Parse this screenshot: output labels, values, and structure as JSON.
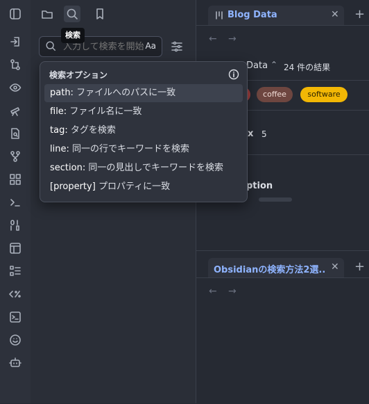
{
  "tooltip": "検索",
  "search": {
    "value": "入力して検索を開始...",
    "match_case": "Aa"
  },
  "popup": {
    "title": "検索オプション",
    "options": [
      {
        "key": "path:",
        "desc": "ファイルへのパスに一致"
      },
      {
        "key": "file:",
        "desc": "ファイル名に一致"
      },
      {
        "key": "tag:",
        "desc": "タグを検索"
      },
      {
        "key": "line:",
        "desc": "同一の行でキーワードを検索"
      },
      {
        "key": "section:",
        "desc": "同一の見出しでキーワードを検索"
      },
      {
        "key": "[property]",
        "desc": "プロパティに一致"
      }
    ]
  },
  "top_pane": {
    "tab_title": "Blog Data",
    "view_name": "Data",
    "result_count": "24 件の結果",
    "tags": [
      "coffee",
      "software"
    ],
    "group_label": "x",
    "group_count": "5",
    "option_label": "ption"
  },
  "bottom_pane": {
    "tab_title": "Obsidianの検索方法2選..."
  },
  "colors": {
    "accent": "#8fb4ff",
    "search_active": "#e0605a",
    "tag_coffee": "#6e4640",
    "tag_software": "#f2b705"
  }
}
